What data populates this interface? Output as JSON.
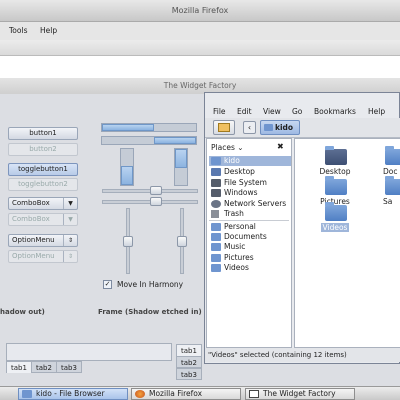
{
  "firefox": {
    "title": "Mozilla Firefox",
    "menu": [
      "Tools",
      "Help"
    ]
  },
  "widget_factory": {
    "title": "The Widget Factory",
    "button1": "button1",
    "button2": "button2",
    "togglebutton1": "togglebutton1",
    "togglebutton2": "togglebutton2",
    "combo1": "ComboBox",
    "combo2": "ComboBox",
    "option1": "OptionMenu",
    "option2": "OptionMenu",
    "move_in_harmony": "Move In Harmony",
    "frame_shadow_out": "hadow out)",
    "frame_shadow_etched": "Frame (Shadow etched in)",
    "tabs_bottom": [
      "tab1",
      "tab2",
      "tab3"
    ],
    "tabs_side": [
      "tab1",
      "tab2",
      "tab3"
    ]
  },
  "file_browser": {
    "menu": [
      "File",
      "Edit",
      "View",
      "Go",
      "Bookmarks",
      "Help"
    ],
    "location": "kido",
    "places_label": "Places",
    "places": [
      "kido",
      "Desktop",
      "File System",
      "Windows",
      "Network Servers",
      "Trash"
    ],
    "bookmarks": [
      "Personal",
      "Documents",
      "Music",
      "Pictures",
      "Videos"
    ],
    "files": [
      "Desktop",
      "Doc",
      "Pictures",
      "Sa",
      "Videos"
    ],
    "status": "\"Videos\" selected (containing 12 items)"
  },
  "taskbar": {
    "items": [
      "kido - File Browser",
      "Mozilla Firefox",
      "The Widget Factory"
    ]
  }
}
